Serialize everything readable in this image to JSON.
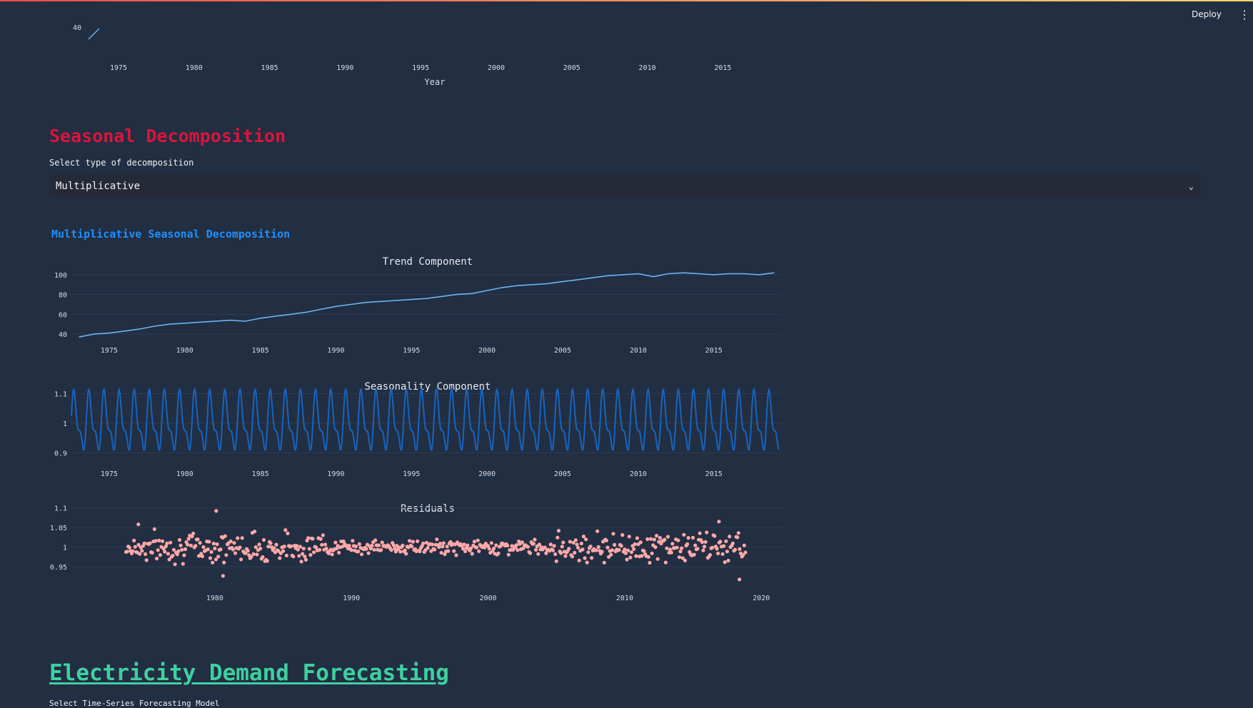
{
  "toolbar": {
    "deploy_label": "Deploy",
    "menu_icon": "more-vertical-icon"
  },
  "top_chart_fragment": {
    "y_tick_partial": "40",
    "x_ticks": [
      "1975",
      "1980",
      "1985",
      "1990",
      "1995",
      "2000",
      "2005",
      "2010",
      "2015"
    ],
    "xlabel": "Year"
  },
  "seasonal_section": {
    "title": "Seasonal Decomposition",
    "select_label": "Select type of decomposition",
    "select_value": "Multiplicative",
    "subtitle": "Multiplicative Seasonal Decomposition"
  },
  "forecast_section": {
    "title": "Electricity Demand Forecasting",
    "select_label": "Select Time-Series Forecasting Model"
  },
  "colors": {
    "trend": "#6cb4ee",
    "seasonality": "#1565c0",
    "residuals": "#ffa8a8",
    "red_heading": "#dc143c",
    "blue_heading": "#1e90ff",
    "green_heading": "#3ed0a0"
  },
  "chart_data": [
    {
      "type": "line",
      "title": "Trend Component",
      "x_ticks": [
        "1975",
        "1980",
        "1985",
        "1990",
        "1995",
        "2000",
        "2005",
        "2010",
        "2015"
      ],
      "y_ticks": [
        "40",
        "60",
        "80",
        "100"
      ],
      "xlim": [
        1972.5,
        2019.5
      ],
      "ylim": [
        35,
        105
      ],
      "x": [
        1973,
        1974,
        1975,
        1976,
        1977,
        1978,
        1979,
        1980,
        1981,
        1982,
        1983,
        1984,
        1985,
        1986,
        1987,
        1988,
        1989,
        1990,
        1991,
        1992,
        1993,
        1994,
        1995,
        1996,
        1997,
        1998,
        1999,
        2000,
        2001,
        2002,
        2003,
        2004,
        2005,
        2006,
        2007,
        2008,
        2009,
        2010,
        2011,
        2012,
        2013,
        2014,
        2015,
        2016,
        2017,
        2018,
        2019
      ],
      "y": [
        37,
        40,
        41,
        43,
        45,
        48,
        50,
        51,
        52,
        53,
        54,
        53,
        56,
        58,
        60,
        62,
        65,
        68,
        70,
        72,
        73,
        74,
        75,
        76,
        78,
        80,
        81,
        84,
        87,
        89,
        90,
        91,
        93,
        95,
        97,
        99,
        100,
        101,
        98,
        101,
        102,
        101,
        100,
        101,
        101,
        100,
        102
      ]
    },
    {
      "type": "line",
      "title": "Seasonality Component",
      "x_ticks": [
        "1975",
        "1980",
        "1985",
        "1990",
        "1995",
        "2000",
        "2005",
        "2010",
        "2015"
      ],
      "y_ticks": [
        "0.9",
        "1",
        "1.1"
      ],
      "xlim": [
        1972.5,
        2019.5
      ],
      "ylim": [
        0.88,
        1.12
      ],
      "period_months": 12,
      "x_start": 1972.5,
      "x_end": 2019.3,
      "amplitude": 0.11,
      "center": 1.0
    },
    {
      "type": "scatter",
      "title": "Residuals",
      "x_ticks": [
        "1980",
        "1990",
        "2000",
        "2010",
        "2020"
      ],
      "y_ticks": [
        "0.95",
        "1",
        "1.05",
        "1.1"
      ],
      "xlim": [
        1969.5,
        2021.5
      ],
      "ylim": [
        0.925,
        1.11
      ],
      "x_start": 1973.5,
      "x_end": 2018.9,
      "points_per_year": 12,
      "center": 1.0,
      "outliers": [
        [
          1980.1,
          1.092
        ],
        [
          1980.6,
          0.927
        ],
        [
          1974.4,
          1.058
        ],
        [
          2018.4,
          0.918
        ],
        [
          2016.9,
          1.065
        ]
      ]
    }
  ]
}
